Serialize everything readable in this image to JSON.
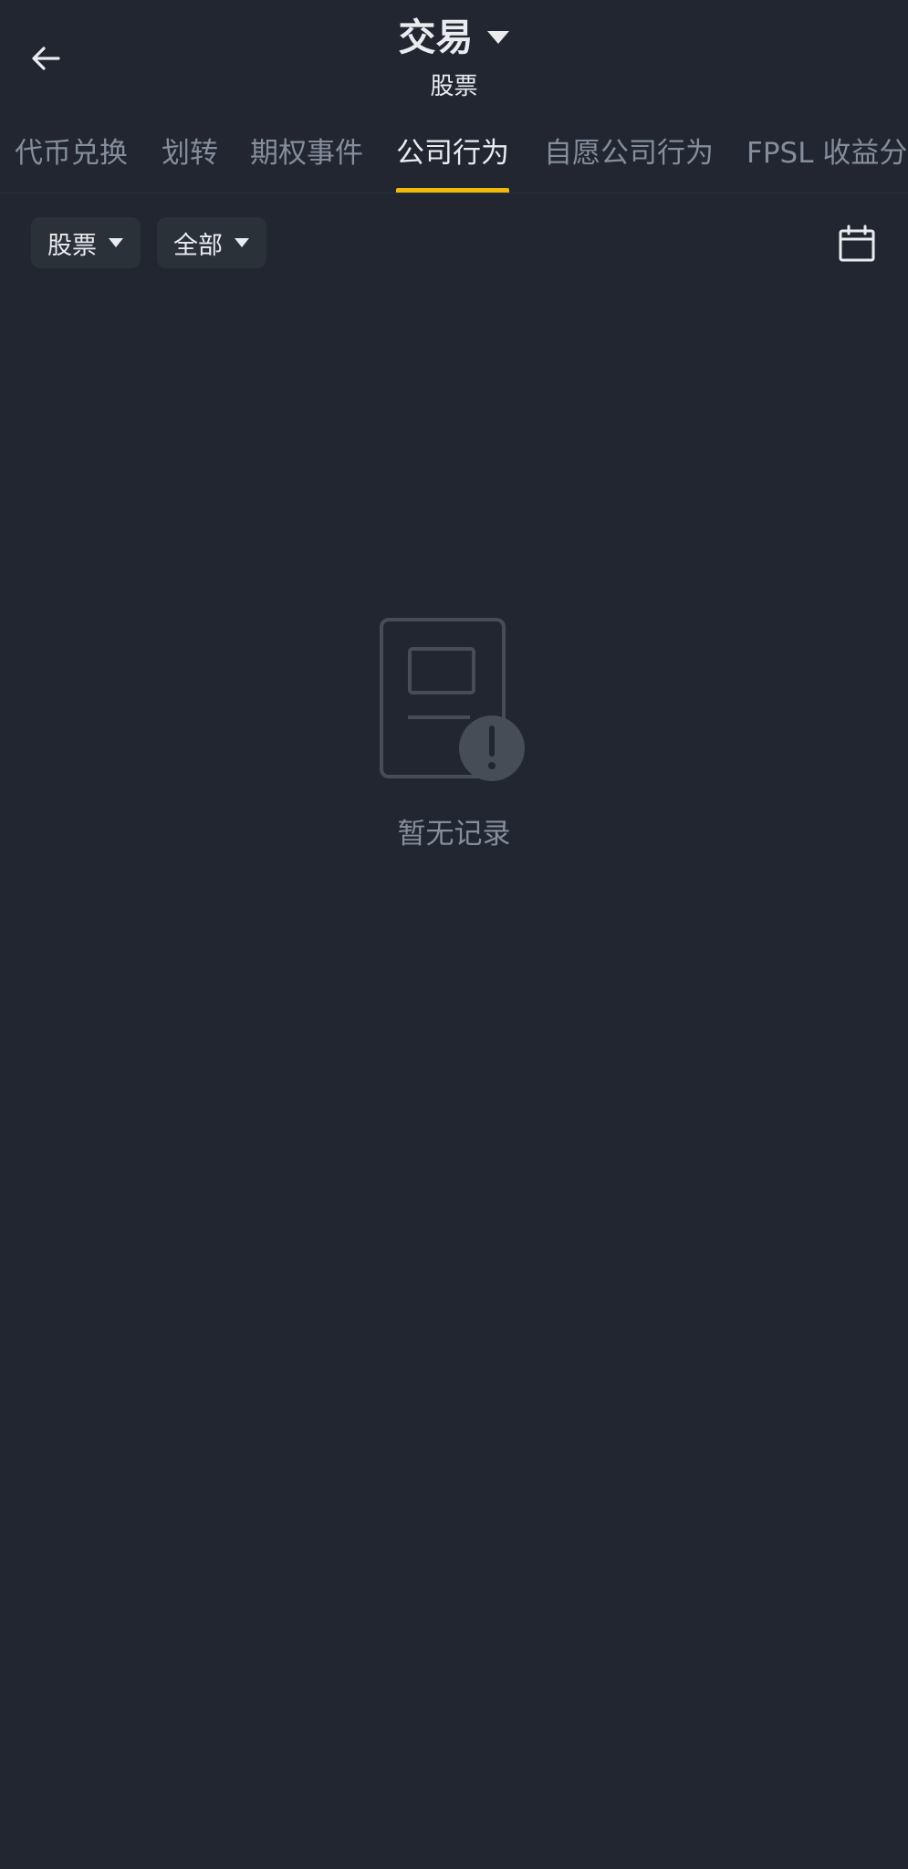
{
  "header": {
    "title": "交易",
    "subtitle": "股票"
  },
  "tabs": [
    {
      "label": "代币兑换",
      "active": false
    },
    {
      "label": "划转",
      "active": false
    },
    {
      "label": "期权事件",
      "active": false
    },
    {
      "label": "公司行为",
      "active": true
    },
    {
      "label": "自愿公司行为",
      "active": false
    },
    {
      "label": "FPSL 收益分",
      "active": false
    }
  ],
  "filters": {
    "asset_type": "股票",
    "status": "全部"
  },
  "empty_state": {
    "message": "暂无记录"
  },
  "colors": {
    "background": "#212630",
    "accent": "#F0B90B",
    "text_primary": "#EAECEF",
    "text_secondary": "#848E9C"
  },
  "icons": {
    "back": "arrow-left-icon",
    "title_dropdown": "caret-down-icon",
    "calendar": "calendar-icon",
    "empty": "empty-record-icon"
  }
}
